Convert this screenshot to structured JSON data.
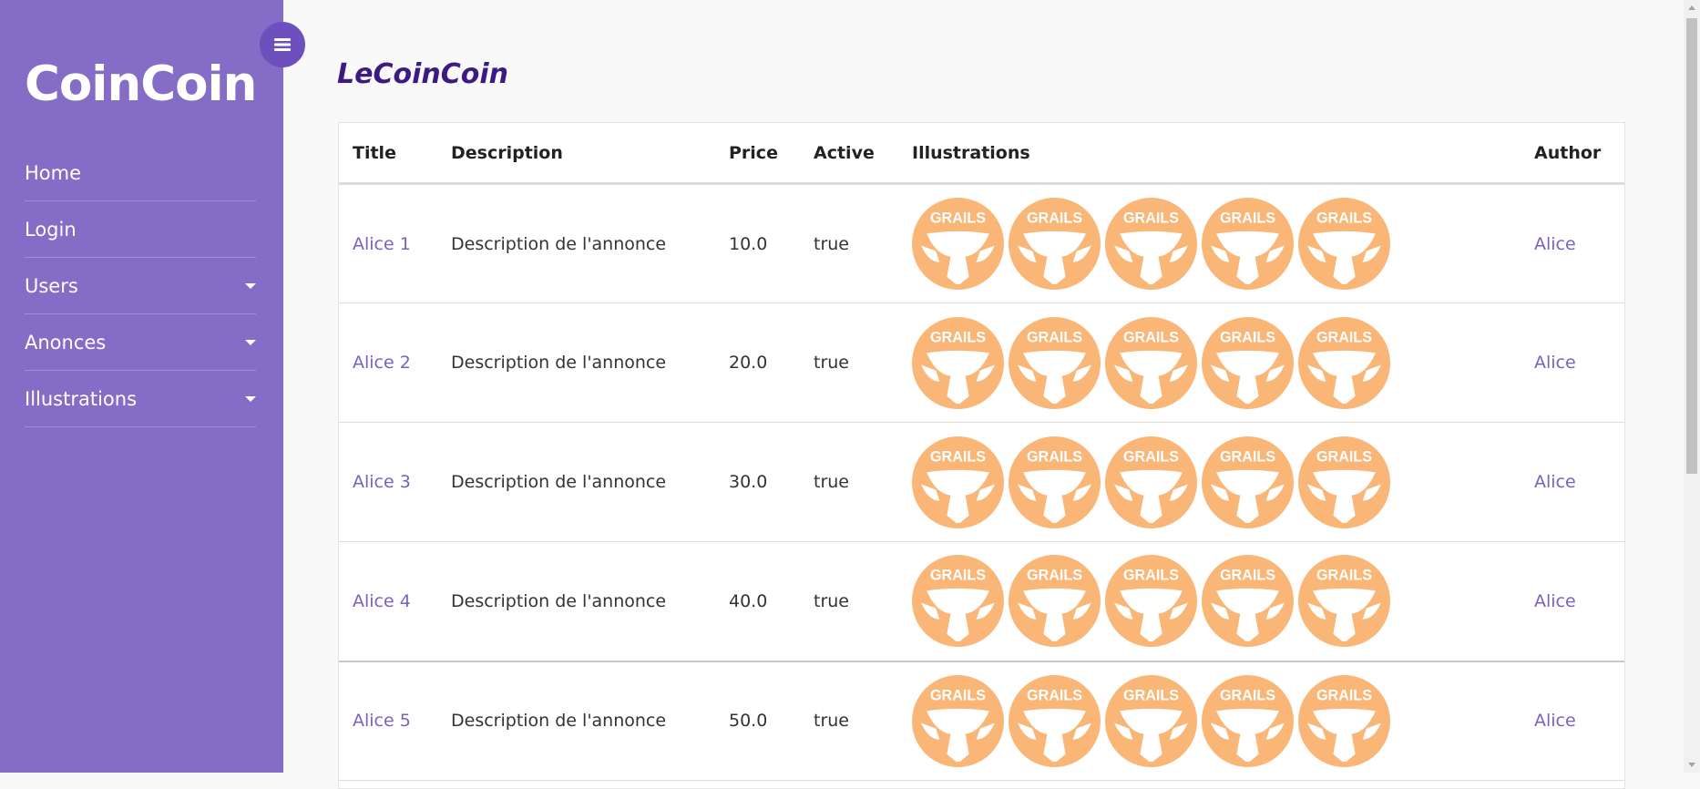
{
  "sidebar": {
    "brand": "CoinCoin",
    "items": [
      {
        "label": "Home"
      },
      {
        "label": "Login"
      },
      {
        "label": "Users"
      },
      {
        "label": "Anonces"
      },
      {
        "label": "Illustrations"
      }
    ]
  },
  "main": {
    "title": "LeCoinCoin",
    "table": {
      "headers": [
        "Title",
        "Description",
        "Price",
        "Active",
        "Illustrations",
        "Author"
      ],
      "rows": [
        {
          "title": "Alice 1",
          "description": "Description de l'annonce",
          "price": "10.0",
          "active": "true",
          "author": "Alice"
        },
        {
          "title": "Alice 2",
          "description": "Description de l'annonce",
          "price": "20.0",
          "active": "true",
          "author": "Alice"
        },
        {
          "title": "Alice 3",
          "description": "Description de l'annonce",
          "price": "30.0",
          "active": "true",
          "author": "Alice"
        },
        {
          "title": "Alice 4",
          "description": "Description de l'annonce",
          "price": "40.0",
          "active": "true",
          "author": "Alice"
        },
        {
          "title": "Alice 5",
          "description": "Description de l'annonce",
          "price": "50.0",
          "active": "true",
          "author": "Alice"
        }
      ]
    },
    "illustration": {
      "text": "GRAILS",
      "color": "#f9b677",
      "icon": "grails-logo-icon"
    }
  }
}
